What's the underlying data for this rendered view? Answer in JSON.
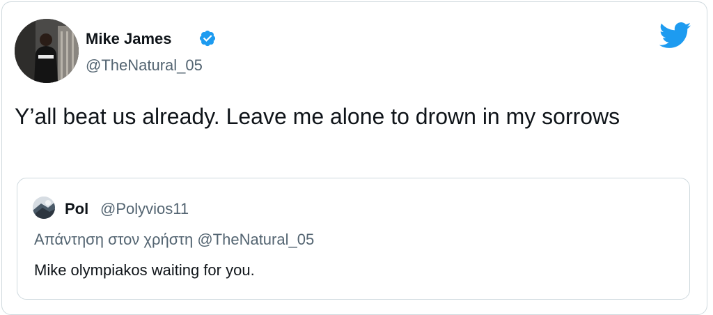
{
  "tweet": {
    "author_name": "Mike James",
    "author_handle": "@TheNatural_05",
    "verified": true,
    "text": "Y’all beat us already. Leave me alone to drown in my sorrows"
  },
  "quoted_tweet": {
    "author_name": "Pol",
    "author_handle": "@Polyvios11",
    "reply_context": "Απάντηση στον χρήστη @TheNatural_05",
    "text": "Mike olympiakos waiting for you."
  },
  "icons": {
    "verified_badge": "verified-badge-icon",
    "platform_logo": "twitter-bird-icon"
  },
  "colors": {
    "verified_blue": "#1d9bf0",
    "brand_blue": "#1d9bf0",
    "secondary_text": "#536471",
    "border": "#cfd9de"
  }
}
